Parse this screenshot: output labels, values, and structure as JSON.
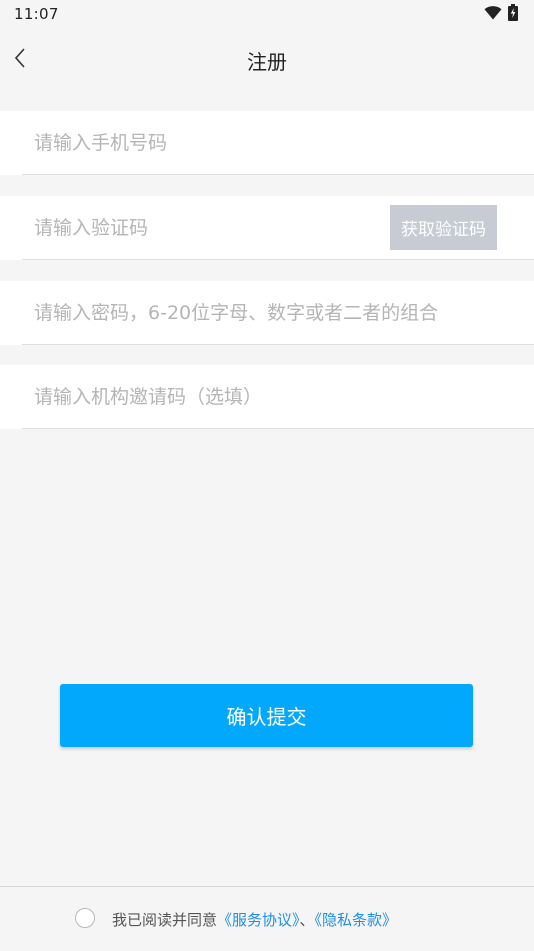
{
  "status_bar": {
    "time": "11:07"
  },
  "header": {
    "title": "注册",
    "back_icon": "chevron-left-icon"
  },
  "form": {
    "phone": {
      "placeholder": "请输入手机号码",
      "value": ""
    },
    "code": {
      "placeholder": "请输入验证码",
      "value": "",
      "button_label": "获取验证码"
    },
    "password": {
      "placeholder": "请输入密码，6-20位字母、数字或者二者的组合",
      "value": ""
    },
    "invite": {
      "placeholder": "请输入机构邀请码（选填）",
      "value": ""
    }
  },
  "submit_label": "确认提交",
  "agreement": {
    "prefix": "我已阅读并同意",
    "service_link": "《服务协议》",
    "separator": "、",
    "privacy_link": "《隐私条款》",
    "checked": false
  },
  "colors": {
    "primary": "#02a8fb",
    "link": "#1f8fe5",
    "disabled_button": "#c7cbd4",
    "background": "#f5f5f5"
  }
}
